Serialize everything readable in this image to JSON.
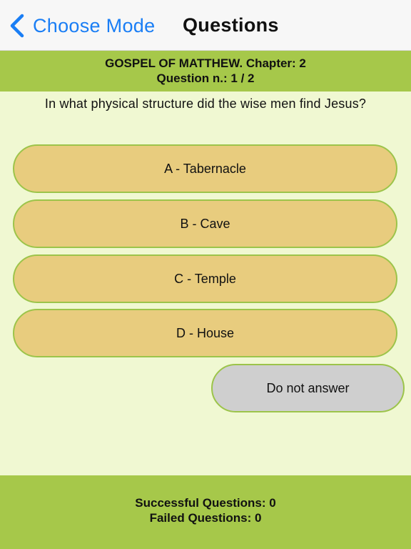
{
  "navbar": {
    "back_label": "Choose Mode",
    "title": "Questions",
    "back_icon": "chevron-left-icon",
    "accent_color": "#1a7ef5"
  },
  "header": {
    "chapter": "GOSPEL OF MATTHEW. Chapter: 2",
    "question_number": "Question n.: 1 / 2"
  },
  "question": {
    "text": "In what physical structure did the wise men find Jesus?"
  },
  "answers": [
    {
      "label": "A - Tabernacle"
    },
    {
      "label": "B - Cave"
    },
    {
      "label": "C - Temple"
    },
    {
      "label": "D - House"
    }
  ],
  "skip": {
    "label": "Do not answer"
  },
  "stats": {
    "successful": "Successful Questions: 0",
    "failed": "Failed Questions: 0"
  },
  "colors": {
    "header_green": "#a6c84a",
    "background": "#f0f8d2",
    "answer_fill": "#e8cc7e",
    "skip_fill": "#cfcfcf"
  }
}
